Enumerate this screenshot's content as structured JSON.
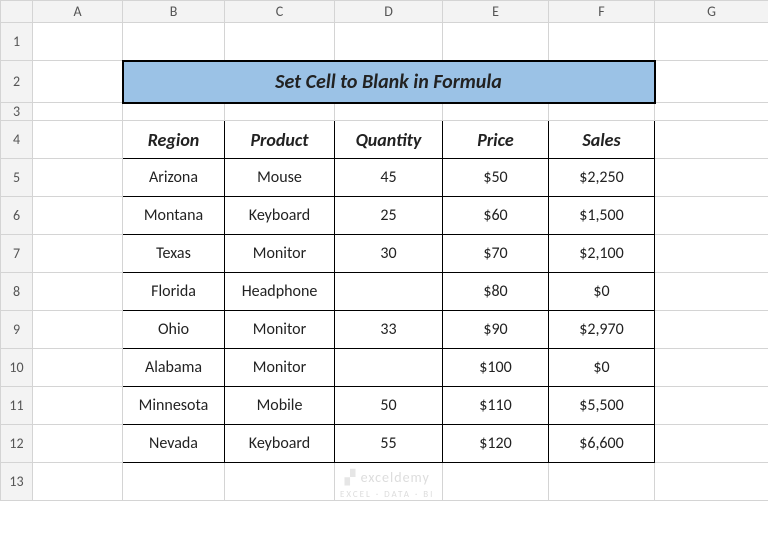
{
  "columns": [
    "",
    "A",
    "B",
    "C",
    "D",
    "E",
    "F",
    "G"
  ],
  "rows": [
    "1",
    "2",
    "3",
    "4",
    "5",
    "6",
    "7",
    "8",
    "9",
    "10",
    "11",
    "12",
    "13"
  ],
  "title": "Set Cell to Blank in Formula",
  "headers": [
    "Region",
    "Product",
    "Quantity",
    "Price",
    "Sales"
  ],
  "data": [
    {
      "region": "Arizona",
      "product": "Mouse",
      "quantity": "45",
      "price": "$50",
      "sales": "$2,250"
    },
    {
      "region": "Montana",
      "product": "Keyboard",
      "quantity": "25",
      "price": "$60",
      "sales": "$1,500"
    },
    {
      "region": "Texas",
      "product": "Monitor",
      "quantity": "30",
      "price": "$70",
      "sales": "$2,100"
    },
    {
      "region": "Florida",
      "product": "Headphone",
      "quantity": "",
      "price": "$80",
      "sales": "$0"
    },
    {
      "region": "Ohio",
      "product": "Monitor",
      "quantity": "33",
      "price": "$90",
      "sales": "$2,970"
    },
    {
      "region": "Alabama",
      "product": "Monitor",
      "quantity": "",
      "price": "$100",
      "sales": "$0"
    },
    {
      "region": "Minnesota",
      "product": "Mobile",
      "quantity": "50",
      "price": "$110",
      "sales": "$5,500"
    },
    {
      "region": "Nevada",
      "product": "Keyboard",
      "quantity": "55",
      "price": "$120",
      "sales": "$6,600"
    }
  ],
  "watermark": {
    "brand": "exceldemy",
    "tag": "EXCEL · DATA · BI"
  }
}
